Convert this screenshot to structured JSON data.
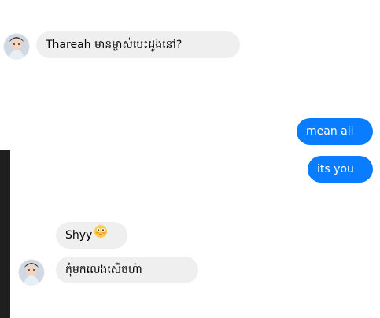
{
  "conversation": {
    "messages": [
      {
        "sender": "contact",
        "text": "Thareah មានម្ចាស់បេះដូងនៅ?"
      },
      {
        "sender": "me",
        "text": "mean aii"
      },
      {
        "sender": "me",
        "text": "its you"
      },
      {
        "sender": "contact",
        "text": "Shyy",
        "emoji": "flushed-face"
      },
      {
        "sender": "contact",
        "text": "កុំមកលេងសើចហ៎ា"
      }
    ]
  },
  "colors": {
    "incoming_bubble": "#efefef",
    "outgoing_bubble": "#0a7cff",
    "incoming_text": "#050505",
    "outgoing_text": "#ffffff",
    "left_strip": "#1f1f1f"
  },
  "icons": {
    "contact_avatar": "contact-avatar-icon",
    "reaction_emoji": "flushed-face-emoji-icon"
  }
}
